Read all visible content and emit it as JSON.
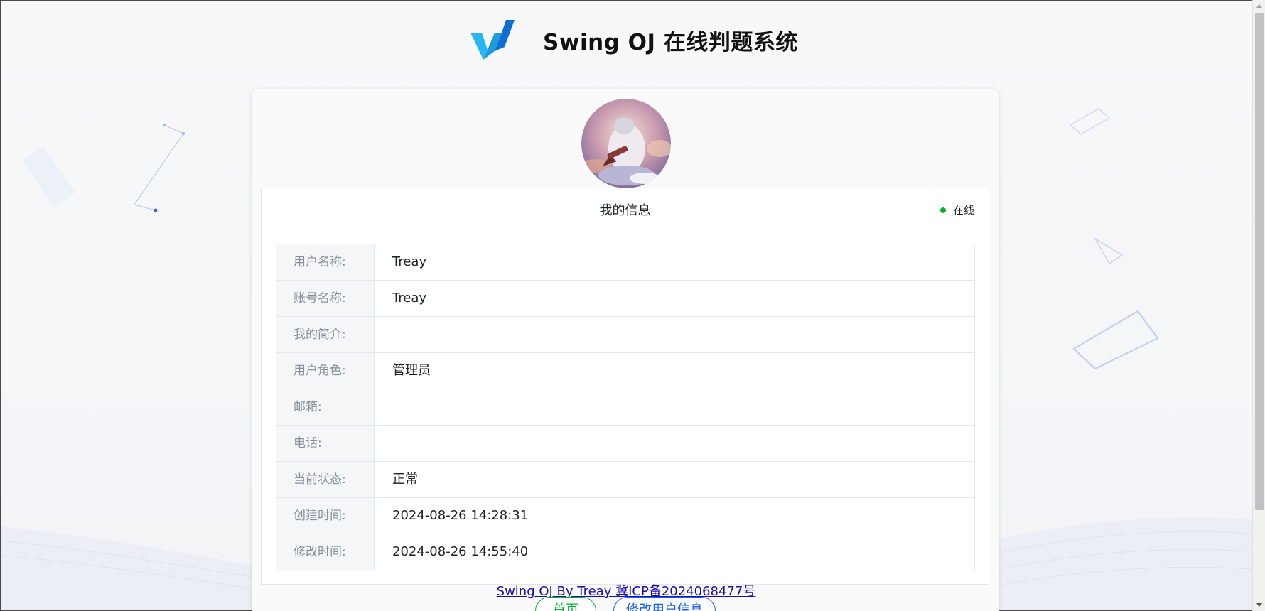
{
  "header": {
    "site_title": "Swing OJ 在线判题系统"
  },
  "profile": {
    "panel_title": "我的信息",
    "online_status": "在线",
    "fields": [
      {
        "label": "用户名称:",
        "value": "Treay"
      },
      {
        "label": "账号名称:",
        "value": "Treay"
      },
      {
        "label": "我的简介:",
        "value": ""
      },
      {
        "label": "用户角色:",
        "value": "管理员"
      },
      {
        "label": "邮箱:",
        "value": ""
      },
      {
        "label": "电话:",
        "value": ""
      },
      {
        "label": "当前状态:",
        "value": "正常"
      },
      {
        "label": "创建时间:",
        "value": "2024-08-26 14:28:31"
      },
      {
        "label": "修改时间:",
        "value": "2024-08-26 14:55:40"
      }
    ]
  },
  "footer": {
    "link_text": "Swing OJ By Treay 冀ICP备2024068477号"
  },
  "actions": {
    "home_label": "首页",
    "edit_label": "修改用户信息"
  },
  "colors": {
    "online_dot": "#00b42a",
    "home_button": "#00b42a",
    "edit_button": "#165dff",
    "logo_light": "#29b6f6",
    "logo_dark": "#0d6fd1"
  }
}
